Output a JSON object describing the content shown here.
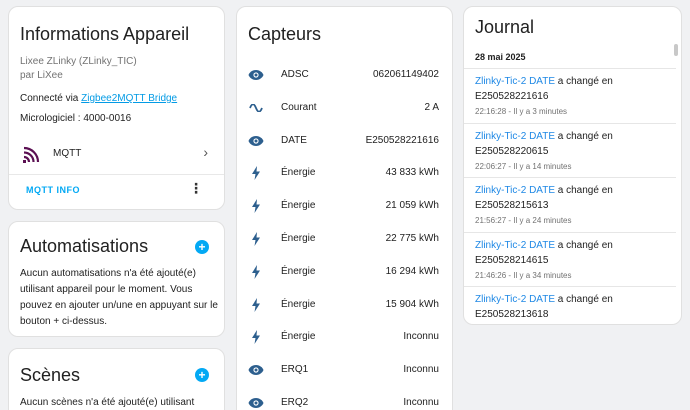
{
  "colors": {
    "accent": "#03a9f4",
    "link": "#039be5",
    "mqtt_logo": "#5b0f52",
    "icon": "#2d5f8e"
  },
  "info": {
    "title": "Informations Appareil",
    "model": "Lixee ZLinky (ZLinky_TIC)",
    "by": "par LiXee",
    "connected_prefix": "Connecté via ",
    "connected_link": "Zigbee2MQTT Bridge",
    "firmware": "Micrologiciel : 4000-0016",
    "mqtt_label": "MQTT",
    "mqtt_info_button": "MQTT INFO"
  },
  "automations": {
    "title": "Automatisations",
    "text": "Aucun automatisations n'a été ajouté(e) utilisant appareil pour le moment. Vous pouvez en ajouter un/une en appuyant sur le bouton + ci-dessus."
  },
  "scenes": {
    "title": "Scènes",
    "text": "Aucun scènes n'a été ajouté(e) utilisant"
  },
  "sensors": {
    "title": "Capteurs",
    "items": [
      {
        "icon": "eye-icon",
        "name": "ADSC",
        "value": "062061149402"
      },
      {
        "icon": "sine-wave-icon",
        "name": "Courant",
        "value": "2 A"
      },
      {
        "icon": "eye-icon",
        "name": "DATE",
        "value": "E250528221616"
      },
      {
        "icon": "lightning-icon",
        "name": "Énergie",
        "value": "43 833 kWh"
      },
      {
        "icon": "lightning-icon",
        "name": "Énergie",
        "value": "21 059 kWh"
      },
      {
        "icon": "lightning-icon",
        "name": "Énergie",
        "value": "22 775 kWh"
      },
      {
        "icon": "lightning-icon",
        "name": "Énergie",
        "value": "16 294 kWh"
      },
      {
        "icon": "lightning-icon",
        "name": "Énergie",
        "value": "15 904 kWh"
      },
      {
        "icon": "lightning-icon",
        "name": "Énergie",
        "value": "Inconnu"
      },
      {
        "icon": "eye-icon",
        "name": "ERQ1",
        "value": "Inconnu"
      },
      {
        "icon": "eye-icon",
        "name": "ERQ2",
        "value": "Inconnu"
      }
    ]
  },
  "journal": {
    "title": "Journal",
    "date": "28 mai 2025",
    "entries": [
      {
        "entity": "Zlinky-Tic-2 DATE",
        "action": " a changé en",
        "value": "E250528221616",
        "time": "22:16:28 - Il y a 3 minutes"
      },
      {
        "entity": "Zlinky-Tic-2 DATE",
        "action": " a changé en",
        "value": "E250528220615",
        "time": "22:06:27 - Il y a 14 minutes"
      },
      {
        "entity": "Zlinky-Tic-2 DATE",
        "action": " a changé en",
        "value": "E250528215613",
        "time": "21:56:27 - Il y a 24 minutes"
      },
      {
        "entity": "Zlinky-Tic-2 DATE",
        "action": " a changé en",
        "value": "E250528214615",
        "time": "21:46:26 - Il y a 34 minutes"
      },
      {
        "entity": "Zlinky-Tic-2 DATE",
        "action": " a changé en",
        "value": "E250528213618",
        "time": ""
      }
    ]
  }
}
